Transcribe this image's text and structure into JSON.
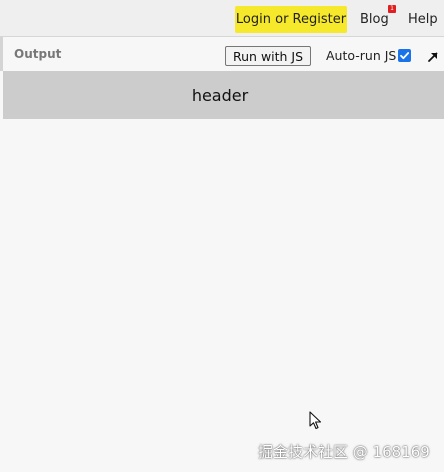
{
  "topbar": {
    "login_label": "Login or Register",
    "blog_label": "Blog",
    "blog_badge": "1",
    "help_label": "Help"
  },
  "output_panel": {
    "title": "Output",
    "run_button_label": "Run with JS",
    "autorun_label": "Auto-run JS",
    "autorun_checked": true,
    "expand_icon": "arrow-up-right-icon"
  },
  "preview": {
    "header_text": "header"
  },
  "watermark": {
    "text": "掘金技术社区 @ 168169"
  },
  "colors": {
    "login_bg": "#f6e82a",
    "badge_bg": "#e02020",
    "checkbox": "#1a73e8",
    "preview_header_bg": "#cccccc",
    "page_bg": "#f7f7f7"
  }
}
